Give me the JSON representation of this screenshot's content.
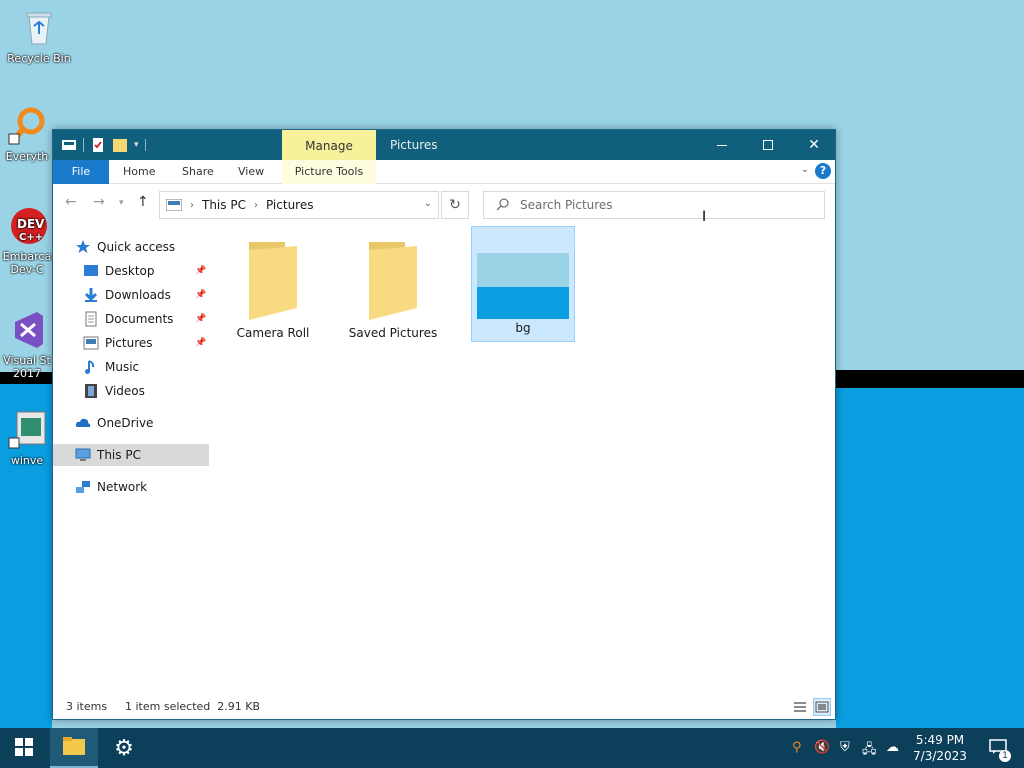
{
  "desktop": {
    "icons": [
      {
        "label": "Recycle Bin"
      },
      {
        "label": "Everyth"
      },
      {
        "label": "Embarca Dev-C"
      },
      {
        "label": "Visual St 2017"
      },
      {
        "label": "winve"
      }
    ]
  },
  "window": {
    "title": "Pictures",
    "context_tab": "Manage",
    "ribbon": {
      "file": "File",
      "home": "Home",
      "share": "Share",
      "view": "View",
      "picture_tools": "Picture Tools",
      "help": "?"
    },
    "breadcrumb": [
      "This PC",
      "Pictures"
    ],
    "search_placeholder": "Search Pictures",
    "nav": [
      {
        "label": "Quick access"
      },
      {
        "label": "Desktop"
      },
      {
        "label": "Downloads"
      },
      {
        "label": "Documents"
      },
      {
        "label": "Pictures"
      },
      {
        "label": "Music"
      },
      {
        "label": "Videos"
      },
      {
        "label": "OneDrive"
      },
      {
        "label": "This PC"
      },
      {
        "label": "Network"
      }
    ],
    "files": [
      {
        "name": "Camera Roll"
      },
      {
        "name": "Saved Pictures"
      },
      {
        "name": "bg"
      }
    ],
    "status": {
      "count": "3 items",
      "selection": "1 item selected  2.91 KB"
    }
  },
  "taskbar": {
    "time": "5:49 PM",
    "date": "7/3/2023",
    "notification_count": "1"
  },
  "colors": {
    "accent": "#1979ca",
    "titlebar": "#0f5f7d",
    "manage_tab": "#f7f19b",
    "taskbar": "#0c3f5a",
    "selection": "#cce8ff"
  }
}
